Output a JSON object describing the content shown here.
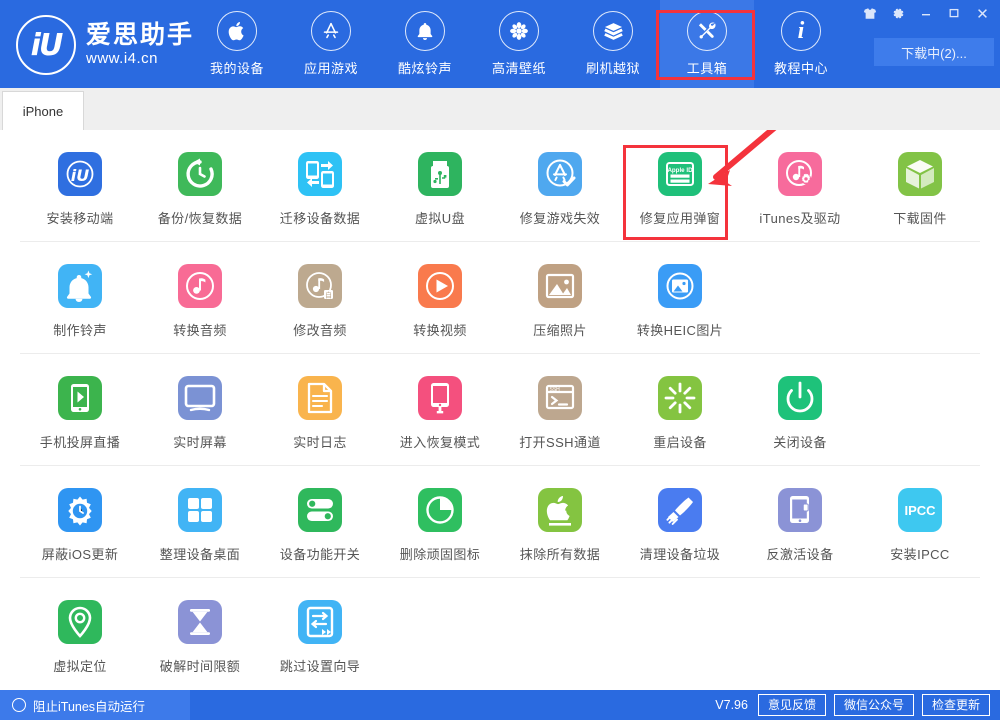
{
  "app": {
    "logo_cn": "爱思助手",
    "logo_url": "www.i4.cn",
    "logo_mark": "iU"
  },
  "header": {
    "nav": [
      {
        "label": "我的设备",
        "icon": "apple-icon",
        "active": false
      },
      {
        "label": "应用游戏",
        "icon": "appstore-icon",
        "active": false
      },
      {
        "label": "酷炫铃声",
        "icon": "bell-icon",
        "active": false
      },
      {
        "label": "高清壁纸",
        "icon": "flower-icon",
        "active": false
      },
      {
        "label": "刷机越狱",
        "icon": "box-open-icon",
        "active": false
      },
      {
        "label": "工具箱",
        "icon": "tools-icon",
        "active": true
      },
      {
        "label": "教程中心",
        "icon": "info-icon",
        "active": false
      }
    ],
    "window_buttons": [
      {
        "name": "skin-button",
        "glyph": "tshirt-icon"
      },
      {
        "name": "settings-button",
        "glyph": "gear-icon"
      },
      {
        "name": "minimize-button",
        "glyph": "minimize-icon"
      },
      {
        "name": "maximize-button",
        "glyph": "maximize-icon"
      },
      {
        "name": "close-button",
        "glyph": "close-icon"
      }
    ],
    "download_button": "下载中(2)..."
  },
  "tabs": [
    {
      "label": "iPhone",
      "active": true
    }
  ],
  "tool_rows": [
    {
      "tools": [
        {
          "label": "安装移动端",
          "icon": "i4-app-icon",
          "bg": "#2f6fe0"
        },
        {
          "label": "备份/恢复数据",
          "icon": "backup-restore-icon",
          "bg": "#3fb95a"
        },
        {
          "label": "迁移设备数据",
          "icon": "migrate-data-icon",
          "bg": "#2ec2f5"
        },
        {
          "label": "虚拟U盘",
          "icon": "usb-drive-icon",
          "bg": "#2eb45f"
        },
        {
          "label": "修复游戏失效",
          "icon": "fix-game-icon",
          "bg": "#4fa8ef"
        },
        {
          "label": "修复应用弹窗",
          "icon": "apple-id-icon",
          "bg": "#1fc07a"
        },
        {
          "label": "iTunes及驱动",
          "icon": "itunes-driver-icon",
          "bg": "#f76b9c"
        },
        {
          "label": "下载固件",
          "icon": "firmware-box-icon",
          "bg": "#82c346"
        }
      ]
    },
    {
      "tools": [
        {
          "label": "制作铃声",
          "icon": "make-ringtone-icon",
          "bg": "#41b4f5"
        },
        {
          "label": "转换音频",
          "icon": "convert-audio-icon",
          "bg": "#f86b95"
        },
        {
          "label": "修改音频",
          "icon": "edit-audio-icon",
          "bg": "#bda98f"
        },
        {
          "label": "转换视频",
          "icon": "convert-video-icon",
          "bg": "#f97a4d"
        },
        {
          "label": "压缩照片",
          "icon": "compress-photo-icon",
          "bg": "#bfa183"
        },
        {
          "label": "转换HEIC图片",
          "icon": "heic-convert-icon",
          "bg": "#3a9cf6"
        }
      ]
    },
    {
      "tools": [
        {
          "label": "手机投屏直播",
          "icon": "screen-cast-icon",
          "bg": "#3cb44d"
        },
        {
          "label": "实时屏幕",
          "icon": "live-screen-icon",
          "bg": "#7b92d4"
        },
        {
          "label": "实时日志",
          "icon": "live-log-icon",
          "bg": "#f9b košt"
        },
        {
          "label": "进入恢复模式",
          "icon": "recovery-mode-icon",
          "bg": "#f4507e"
        },
        {
          "label": "打开SSH通道",
          "icon": "ssh-terminal-icon",
          "bg": "#bda78f"
        },
        {
          "label": "重启设备",
          "icon": "reboot-icon",
          "bg": "#84c441"
        },
        {
          "label": "关闭设备",
          "icon": "power-off-icon",
          "bg": "#1ec27a"
        }
      ]
    },
    {
      "tools": [
        {
          "label": "屏蔽iOS更新",
          "icon": "block-update-icon",
          "bg": "#2f95f2"
        },
        {
          "label": "整理设备桌面",
          "icon": "organize-home-icon",
          "bg": "#41b4f5"
        },
        {
          "label": "设备功能开关",
          "icon": "feature-toggle-icon",
          "bg": "#2fb85c"
        },
        {
          "label": "删除顽固图标",
          "icon": "delete-icon-icon",
          "bg": "#2fbf60"
        },
        {
          "label": "抹除所有数据",
          "icon": "erase-data-icon",
          "bg": "#84c441"
        },
        {
          "label": "清理设备垃圾",
          "icon": "clean-junk-icon",
          "bg": "#4a7cf0"
        },
        {
          "label": "反激活设备",
          "icon": "deactivate-icon",
          "bg": "#8b93d6"
        },
        {
          "label": "安装IPCC",
          "icon": "ipcc-icon",
          "bg": "#3ec8f0"
        }
      ]
    },
    {
      "tools": [
        {
          "label": "虚拟定位",
          "icon": "virtual-location-icon",
          "bg": "#2fb85c"
        },
        {
          "label": "破解时间限额",
          "icon": "time-limit-icon",
          "bg": "#8b93d6"
        },
        {
          "label": "跳过设置向导",
          "icon": "skip-setup-icon",
          "bg": "#41b4f5"
        }
      ]
    }
  ],
  "statusbar": {
    "block_itunes": "阻止iTunes自动运行",
    "version": "V7.96",
    "buttons": [
      "意见反馈",
      "微信公众号",
      "检查更新"
    ]
  },
  "colors": {
    "brand_blue": "#2a6ae0",
    "highlight_red": "#f4333c",
    "active_nav": "#3b78e7"
  }
}
